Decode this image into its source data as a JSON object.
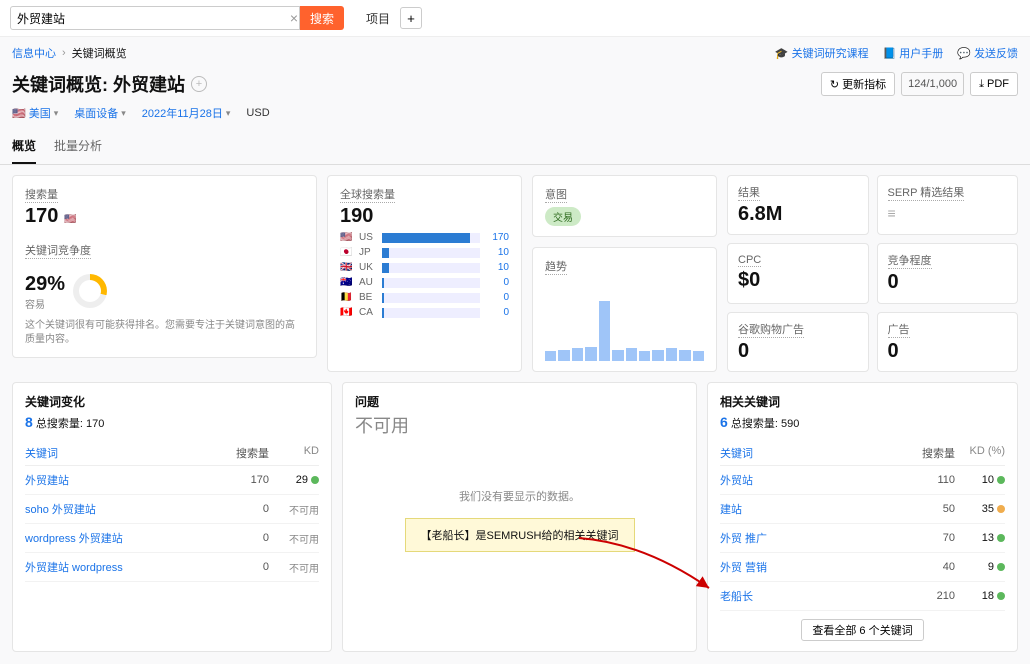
{
  "search": {
    "value": "外贸建站",
    "button": "搜索",
    "project_label": "项目",
    "add": "+"
  },
  "breadcrumb": {
    "home": "信息中心",
    "current": "关键词概览"
  },
  "toplinks": {
    "course": "关键词研究课程",
    "manual": "用户手册",
    "feedback": "发送反馈"
  },
  "title": {
    "prefix": "关键词概览:",
    "keyword": "外贸建站"
  },
  "actions": {
    "refresh": "更新指标",
    "quota": "124/1,000",
    "pdf": "PDF"
  },
  "filters": {
    "country": "美国",
    "device": "桌面设备",
    "date": "2022年11月28日",
    "currency": "USD"
  },
  "tabs": {
    "t1": "概览",
    "t2": "批量分析"
  },
  "vol": {
    "label": "搜索量",
    "value": "170"
  },
  "kd": {
    "label": "关键词竞争度",
    "value": "29%",
    "level": "容易",
    "note": "这个关键词很有可能获得排名。您需要专注于关键词意图的高质量内容。"
  },
  "global": {
    "label": "全球搜索量",
    "value": "190",
    "rows": [
      {
        "flag": "🇺🇸",
        "code": "US",
        "val": 170,
        "pct": 90
      },
      {
        "flag": "🇯🇵",
        "code": "JP",
        "val": 10,
        "pct": 7
      },
      {
        "flag": "🇬🇧",
        "code": "UK",
        "val": 10,
        "pct": 7
      },
      {
        "flag": "🇦🇺",
        "code": "AU",
        "val": 0,
        "pct": 2
      },
      {
        "flag": "🇧🇪",
        "code": "BE",
        "val": 0,
        "pct": 2
      },
      {
        "flag": "🇨🇦",
        "code": "CA",
        "val": 0,
        "pct": 2
      }
    ]
  },
  "intent": {
    "label": "意图",
    "pill": "交易"
  },
  "trend": {
    "label": "趋势",
    "bars": [
      12,
      14,
      16,
      18,
      75,
      14,
      16,
      12,
      14,
      16,
      14,
      12
    ]
  },
  "metrics": {
    "results": {
      "label": "结果",
      "value": "6.8M"
    },
    "serp": {
      "label": "SERP 精选结果",
      "value": "—"
    },
    "cpc": {
      "label": "CPC",
      "value": "$0"
    },
    "comp": {
      "label": "竞争程度",
      "value": "0"
    },
    "pla": {
      "label": "谷歌购物广告",
      "value": "0"
    },
    "ads": {
      "label": "广告",
      "value": "0"
    }
  },
  "variations": {
    "title": "关键词变化",
    "count": "8",
    "sub": "总搜索量: 170",
    "cols": {
      "kw": "关键词",
      "vol": "搜索量",
      "kd": "KD"
    },
    "rows": [
      {
        "kw": "外贸建站",
        "vol": 170,
        "kd": 29,
        "color": "#5cb85c"
      },
      {
        "kw": "soho 外贸建站",
        "vol": 0,
        "kd": null
      },
      {
        "kw": "wordpress 外贸建站",
        "vol": 0,
        "kd": null
      },
      {
        "kw": "外贸建站 wordpress",
        "vol": 0,
        "kd": null
      }
    ],
    "na": "不可用"
  },
  "questions": {
    "title": "问题",
    "na": "不可用",
    "msg": "我们没有要显示的数据。"
  },
  "callout": "【老船长】是SEMRUSH给的相关关键词",
  "related": {
    "title": "相关关键词",
    "count": "6",
    "sub": "总搜索量: 590",
    "cols": {
      "kw": "关键词",
      "vol": "搜索量",
      "kd": "KD (%)"
    },
    "rows": [
      {
        "kw": "外贸站",
        "vol": 110,
        "kd": 10,
        "color": "#5cb85c"
      },
      {
        "kw": "建站",
        "vol": 50,
        "kd": 35,
        "color": "#f0ad4e"
      },
      {
        "kw": "外贸 推广",
        "vol": 70,
        "kd": 13,
        "color": "#5cb85c"
      },
      {
        "kw": "外贸 营销",
        "vol": 40,
        "kd": 9,
        "color": "#5cb85c"
      },
      {
        "kw": "老船长",
        "vol": 210,
        "kd": 18,
        "color": "#5cb85c"
      }
    ],
    "all_btn": "查看全部 6 个关键词"
  }
}
